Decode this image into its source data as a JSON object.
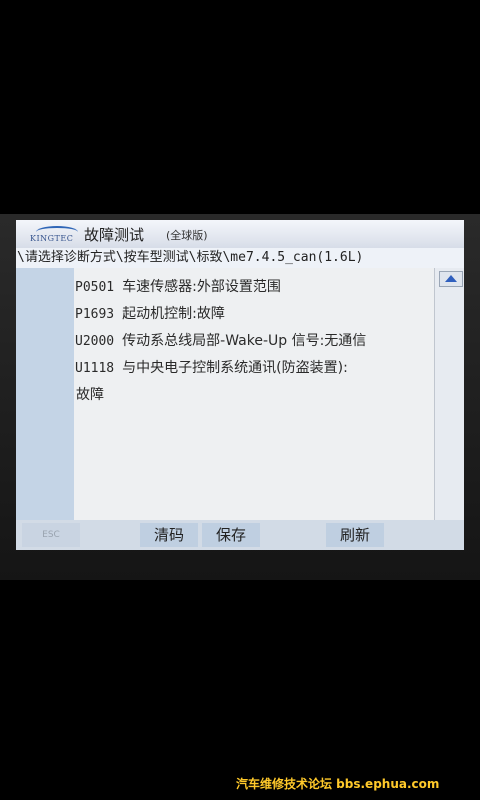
{
  "app": {
    "logo_text": "KINGTEC",
    "title": "故障测试",
    "subtitle": "(全球版)"
  },
  "breadcrumb": {
    "text": "\\请选择诊断方式\\按车型测试\\标致\\me7.4.5_can(1.6L)"
  },
  "dtc_list": [
    {
      "code": "P0501",
      "description": "车速传感器:外部设置范围",
      "continuation": ""
    },
    {
      "code": "P1693",
      "description": "起动机控制:故障",
      "continuation": ""
    },
    {
      "code": "U2000",
      "description": "传动系总线局部-Wake-Up 信号:无通信",
      "continuation": ""
    },
    {
      "code": "U1118",
      "description": "与中央电子控制系统通讯(防盗装置):",
      "continuation": "故障"
    }
  ],
  "softkeys": {
    "esc": "ESC",
    "clear": "清码",
    "save": "保存",
    "refresh": "刷新"
  },
  "watermark": "汽车维修技术论坛 bbs.ephua.com"
}
